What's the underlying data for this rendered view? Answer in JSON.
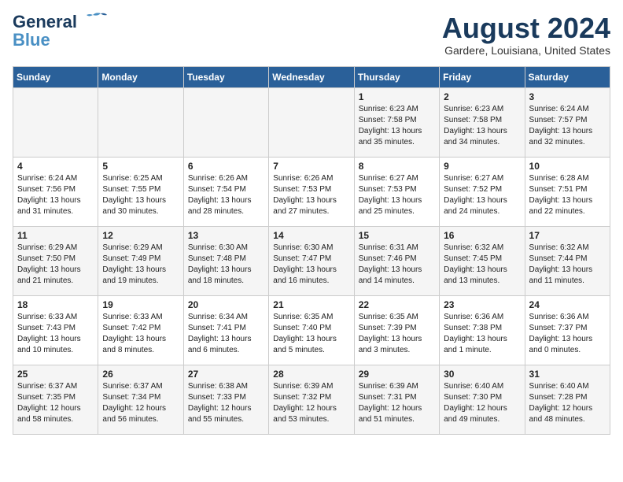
{
  "header": {
    "logo_line1": "General",
    "logo_line2": "Blue",
    "month": "August 2024",
    "location": "Gardere, Louisiana, United States"
  },
  "weekdays": [
    "Sunday",
    "Monday",
    "Tuesday",
    "Wednesday",
    "Thursday",
    "Friday",
    "Saturday"
  ],
  "weeks": [
    [
      {
        "day": "",
        "info": ""
      },
      {
        "day": "",
        "info": ""
      },
      {
        "day": "",
        "info": ""
      },
      {
        "day": "",
        "info": ""
      },
      {
        "day": "1",
        "info": "Sunrise: 6:23 AM\nSunset: 7:58 PM\nDaylight: 13 hours\nand 35 minutes."
      },
      {
        "day": "2",
        "info": "Sunrise: 6:23 AM\nSunset: 7:58 PM\nDaylight: 13 hours\nand 34 minutes."
      },
      {
        "day": "3",
        "info": "Sunrise: 6:24 AM\nSunset: 7:57 PM\nDaylight: 13 hours\nand 32 minutes."
      }
    ],
    [
      {
        "day": "4",
        "info": "Sunrise: 6:24 AM\nSunset: 7:56 PM\nDaylight: 13 hours\nand 31 minutes."
      },
      {
        "day": "5",
        "info": "Sunrise: 6:25 AM\nSunset: 7:55 PM\nDaylight: 13 hours\nand 30 minutes."
      },
      {
        "day": "6",
        "info": "Sunrise: 6:26 AM\nSunset: 7:54 PM\nDaylight: 13 hours\nand 28 minutes."
      },
      {
        "day": "7",
        "info": "Sunrise: 6:26 AM\nSunset: 7:53 PM\nDaylight: 13 hours\nand 27 minutes."
      },
      {
        "day": "8",
        "info": "Sunrise: 6:27 AM\nSunset: 7:53 PM\nDaylight: 13 hours\nand 25 minutes."
      },
      {
        "day": "9",
        "info": "Sunrise: 6:27 AM\nSunset: 7:52 PM\nDaylight: 13 hours\nand 24 minutes."
      },
      {
        "day": "10",
        "info": "Sunrise: 6:28 AM\nSunset: 7:51 PM\nDaylight: 13 hours\nand 22 minutes."
      }
    ],
    [
      {
        "day": "11",
        "info": "Sunrise: 6:29 AM\nSunset: 7:50 PM\nDaylight: 13 hours\nand 21 minutes."
      },
      {
        "day": "12",
        "info": "Sunrise: 6:29 AM\nSunset: 7:49 PM\nDaylight: 13 hours\nand 19 minutes."
      },
      {
        "day": "13",
        "info": "Sunrise: 6:30 AM\nSunset: 7:48 PM\nDaylight: 13 hours\nand 18 minutes."
      },
      {
        "day": "14",
        "info": "Sunrise: 6:30 AM\nSunset: 7:47 PM\nDaylight: 13 hours\nand 16 minutes."
      },
      {
        "day": "15",
        "info": "Sunrise: 6:31 AM\nSunset: 7:46 PM\nDaylight: 13 hours\nand 14 minutes."
      },
      {
        "day": "16",
        "info": "Sunrise: 6:32 AM\nSunset: 7:45 PM\nDaylight: 13 hours\nand 13 minutes."
      },
      {
        "day": "17",
        "info": "Sunrise: 6:32 AM\nSunset: 7:44 PM\nDaylight: 13 hours\nand 11 minutes."
      }
    ],
    [
      {
        "day": "18",
        "info": "Sunrise: 6:33 AM\nSunset: 7:43 PM\nDaylight: 13 hours\nand 10 minutes."
      },
      {
        "day": "19",
        "info": "Sunrise: 6:33 AM\nSunset: 7:42 PM\nDaylight: 13 hours\nand 8 minutes."
      },
      {
        "day": "20",
        "info": "Sunrise: 6:34 AM\nSunset: 7:41 PM\nDaylight: 13 hours\nand 6 minutes."
      },
      {
        "day": "21",
        "info": "Sunrise: 6:35 AM\nSunset: 7:40 PM\nDaylight: 13 hours\nand 5 minutes."
      },
      {
        "day": "22",
        "info": "Sunrise: 6:35 AM\nSunset: 7:39 PM\nDaylight: 13 hours\nand 3 minutes."
      },
      {
        "day": "23",
        "info": "Sunrise: 6:36 AM\nSunset: 7:38 PM\nDaylight: 13 hours\nand 1 minute."
      },
      {
        "day": "24",
        "info": "Sunrise: 6:36 AM\nSunset: 7:37 PM\nDaylight: 13 hours\nand 0 minutes."
      }
    ],
    [
      {
        "day": "25",
        "info": "Sunrise: 6:37 AM\nSunset: 7:35 PM\nDaylight: 12 hours\nand 58 minutes."
      },
      {
        "day": "26",
        "info": "Sunrise: 6:37 AM\nSunset: 7:34 PM\nDaylight: 12 hours\nand 56 minutes."
      },
      {
        "day": "27",
        "info": "Sunrise: 6:38 AM\nSunset: 7:33 PM\nDaylight: 12 hours\nand 55 minutes."
      },
      {
        "day": "28",
        "info": "Sunrise: 6:39 AM\nSunset: 7:32 PM\nDaylight: 12 hours\nand 53 minutes."
      },
      {
        "day": "29",
        "info": "Sunrise: 6:39 AM\nSunset: 7:31 PM\nDaylight: 12 hours\nand 51 minutes."
      },
      {
        "day": "30",
        "info": "Sunrise: 6:40 AM\nSunset: 7:30 PM\nDaylight: 12 hours\nand 49 minutes."
      },
      {
        "day": "31",
        "info": "Sunrise: 6:40 AM\nSunset: 7:28 PM\nDaylight: 12 hours\nand 48 minutes."
      }
    ]
  ]
}
